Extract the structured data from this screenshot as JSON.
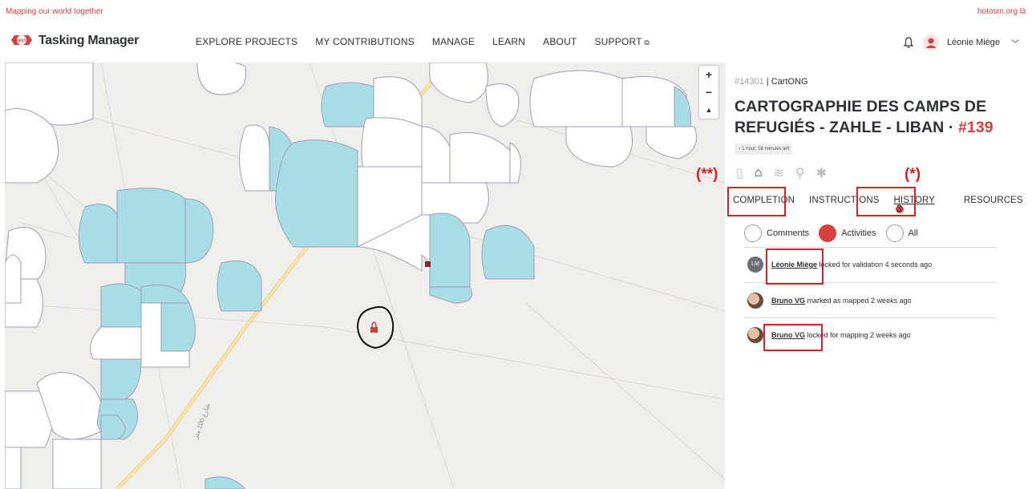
{
  "topbar": {
    "tagline": "Mapping our world together",
    "external_link": "hotosm.org"
  },
  "header": {
    "brand": "Tasking Manager",
    "logo_text": "HOT",
    "nav": [
      {
        "label": "EXPLORE PROJECTS"
      },
      {
        "label": "MY CONTRIBUTIONS"
      },
      {
        "label": "MANAGE"
      },
      {
        "label": "LEARN"
      },
      {
        "label": "ABOUT"
      },
      {
        "label": "SUPPORT"
      }
    ],
    "user_name": "Léonie Miège"
  },
  "map": {
    "zoom_in": "+",
    "zoom_out": "−",
    "compass": "▲",
    "road_label": "شارع 100 متر"
  },
  "project": {
    "id": "#14301",
    "org": "CartONG",
    "title": "CARTOGRAPHIE DES CAMPS DE REFUGIÉS - ZAHLE - LIBAN",
    "task_number": "#139",
    "time_left": "1 hour, 58 minutes left"
  },
  "tabs": [
    {
      "label": "COMPLETION"
    },
    {
      "label": "INSTRUCTIONS"
    },
    {
      "label": "HISTORY",
      "badge": "3"
    },
    {
      "label": "RESOURCES"
    }
  ],
  "filters": [
    {
      "label": "Comments",
      "selected": false
    },
    {
      "label": "Activities",
      "selected": true
    },
    {
      "label": "All",
      "selected": false
    }
  ],
  "activities": [
    {
      "user": "Léonie Miège",
      "initials": "LM",
      "action": "locked for validation 4 seconds ago"
    },
    {
      "user": "Bruno VG",
      "initials": "",
      "action": "marked as mapped 2 weeks ago"
    },
    {
      "user": "Bruno VG",
      "initials": "",
      "action": "locked for mapping 2 weeks ago"
    }
  ],
  "annotations": {
    "mark_double": "(**)",
    "mark_single": "(*)"
  },
  "colors": {
    "accent": "#d73f3f",
    "tile_blue": "#a8dde6",
    "map_bg": "#f0eeea"
  }
}
